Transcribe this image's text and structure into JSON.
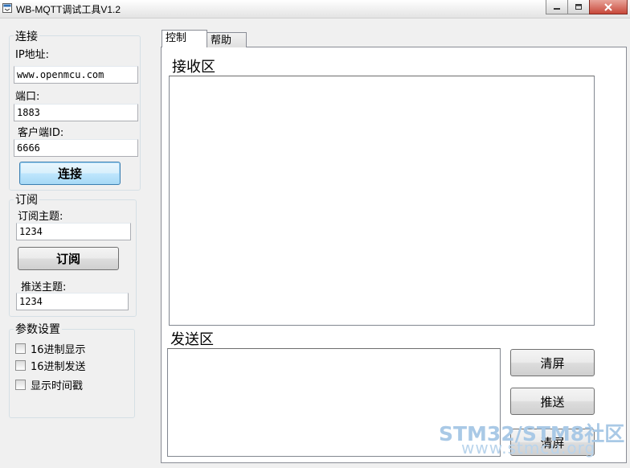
{
  "window": {
    "title": "WB-MQTT调试工具V1.2",
    "controls": [
      "minimize-icon",
      "maximize-icon",
      "close-icon"
    ]
  },
  "connect": {
    "group_title": "连接",
    "ip_label": "IP地址:",
    "ip_value": "www.openmcu.com",
    "port_label": "端口:",
    "port_value": "1883",
    "client_id_label": "客户端ID:",
    "client_id_value": "6666",
    "connect_button": "连接"
  },
  "subscribe": {
    "group_title": "订阅",
    "topic_label": "订阅主题:",
    "topic_value": "1234",
    "subscribe_button": "订阅",
    "publish_topic_label": "推送主题:",
    "publish_topic_value": "1234"
  },
  "settings": {
    "group_title": "参数设置",
    "options": [
      {
        "label": "16进制显示",
        "checked": false
      },
      {
        "label": "16进制发送",
        "checked": false
      },
      {
        "label": "显示时间戳",
        "checked": false
      }
    ]
  },
  "tabs": [
    {
      "label": "控制",
      "active": true
    },
    {
      "label": "帮助",
      "active": false
    }
  ],
  "receive": {
    "section_label": "接收区",
    "content": ""
  },
  "send": {
    "section_label": "发送区",
    "content": "",
    "clear_button": "清屏",
    "publish_button": "推送",
    "clear_button_2": "清屏"
  },
  "watermark": {
    "line1": "STM32/STM8社区",
    "line2": "www.stmcu.org"
  },
  "colors": {
    "accent_focus": "#3c7fb1",
    "close_button": "#c8483a",
    "watermark": "#a9c9e6"
  }
}
